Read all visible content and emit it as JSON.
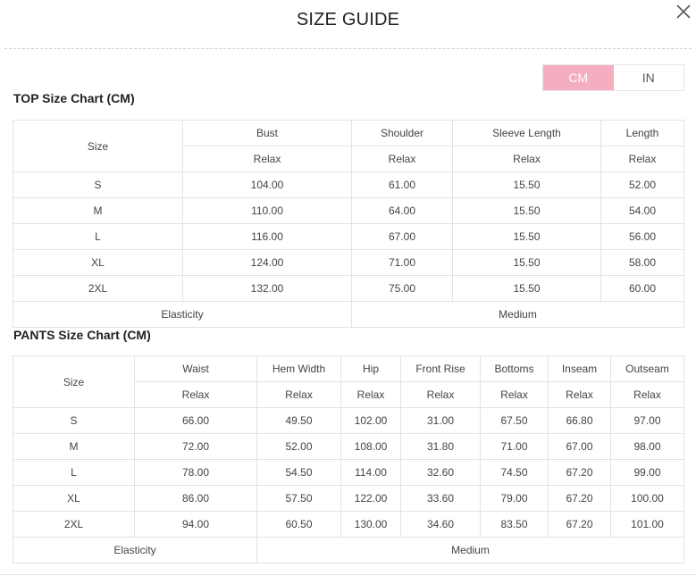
{
  "modal": {
    "title": "SIZE GUIDE"
  },
  "units": {
    "cm": "CM",
    "in": "IN",
    "selected": "CM"
  },
  "top": {
    "title": "TOP Size Chart (CM)",
    "size_header": "Size",
    "columns": [
      "Bust",
      "Shoulder",
      "Sleeve Length",
      "Length"
    ],
    "sub": [
      "Relax",
      "Relax",
      "Relax",
      "Relax"
    ],
    "rows": [
      [
        "S",
        "104.00",
        "61.00",
        "15.50",
        "52.00"
      ],
      [
        "M",
        "110.00",
        "64.00",
        "15.50",
        "54.00"
      ],
      [
        "L",
        "116.00",
        "67.00",
        "15.50",
        "56.00"
      ],
      [
        "XL",
        "124.00",
        "71.00",
        "15.50",
        "58.00"
      ],
      [
        "2XL",
        "132.00",
        "75.00",
        "15.50",
        "60.00"
      ]
    ],
    "elasticity_label": "Elasticity",
    "elasticity_value": "Medium"
  },
  "pants": {
    "title": "PANTS Size Chart (CM)",
    "size_header": "Size",
    "columns": [
      "Waist",
      "Hem Width",
      "Hip",
      "Front Rise",
      "Bottoms",
      "Inseam",
      "Outseam"
    ],
    "sub": [
      "Relax",
      "Relax",
      "Relax",
      "Relax",
      "Relax",
      "Relax",
      "Relax"
    ],
    "rows": [
      [
        "S",
        "66.00",
        "49.50",
        "102.00",
        "31.00",
        "67.50",
        "66.80",
        "97.00"
      ],
      [
        "M",
        "72.00",
        "52.00",
        "108.00",
        "31.80",
        "71.00",
        "67.00",
        "98.00"
      ],
      [
        "L",
        "78.00",
        "54.50",
        "114.00",
        "32.60",
        "74.50",
        "67.20",
        "99.00"
      ],
      [
        "XL",
        "86.00",
        "57.50",
        "122.00",
        "33.60",
        "79.00",
        "67.20",
        "100.00"
      ],
      [
        "2XL",
        "94.00",
        "60.50",
        "130.00",
        "34.60",
        "83.50",
        "67.20",
        "101.00"
      ]
    ],
    "elasticity_label": "Elasticity",
    "elasticity_value": "Medium"
  },
  "icons": {
    "close": "close-icon"
  },
  "colors": {
    "accent": "#f5aec0",
    "border": "#e3e3e3"
  }
}
